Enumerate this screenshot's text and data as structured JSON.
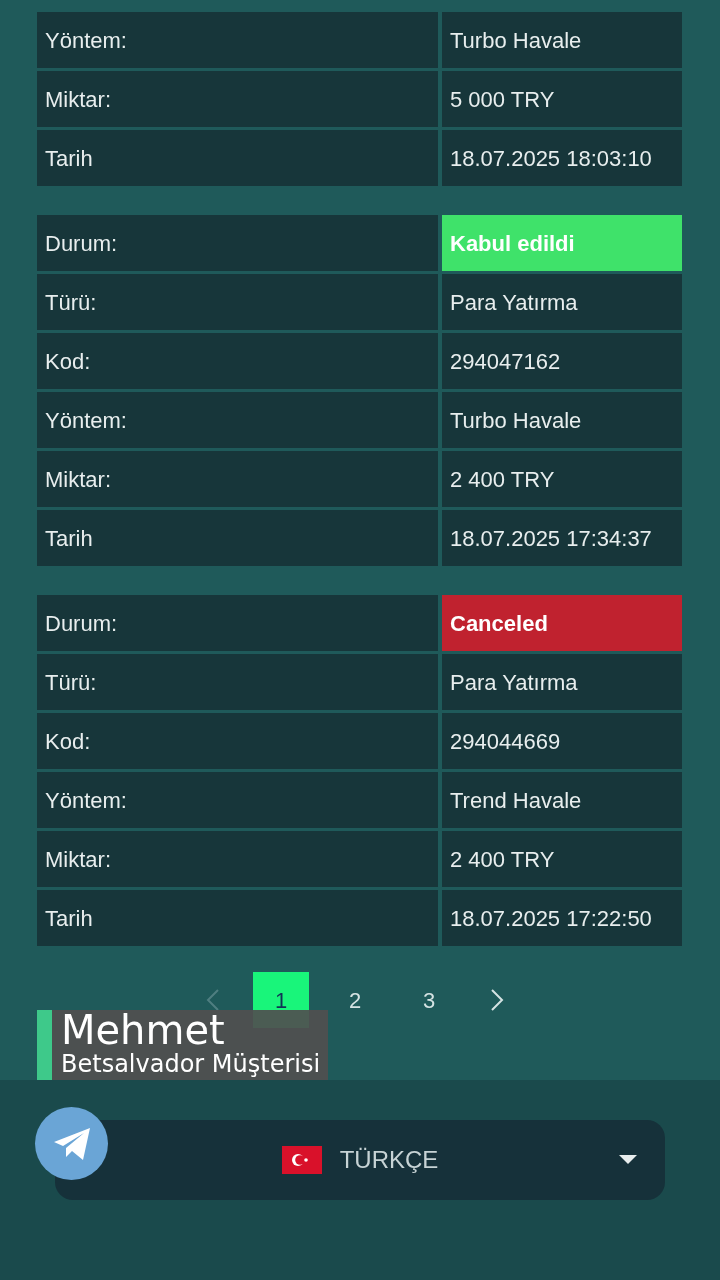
{
  "transactions": [
    {
      "rows": [
        {
          "label": "Yöntem:",
          "value": "Turbo Havale"
        },
        {
          "label": "Miktar:",
          "value": "5 000 TRY"
        },
        {
          "label": "Tarih",
          "value": "18.07.2025 18:03:10"
        }
      ]
    },
    {
      "status": {
        "label": "Durum:",
        "value": "Kabul edildi",
        "kind": "accepted"
      },
      "rows": [
        {
          "label": "Türü:",
          "value": "Para Yatırma"
        },
        {
          "label": "Kod:",
          "value": "294047162"
        },
        {
          "label": "Yöntem:",
          "value": "Turbo Havale"
        },
        {
          "label": "Miktar:",
          "value": "2 400 TRY"
        },
        {
          "label": "Tarih",
          "value": "18.07.2025 17:34:37"
        }
      ]
    },
    {
      "status": {
        "label": "Durum:",
        "value": "Canceled",
        "kind": "canceled"
      },
      "rows": [
        {
          "label": "Türü:",
          "value": "Para Yatırma"
        },
        {
          "label": "Kod:",
          "value": "294044669"
        },
        {
          "label": "Yöntem:",
          "value": "Trend Havale"
        },
        {
          "label": "Miktar:",
          "value": "2 400 TRY"
        },
        {
          "label": "Tarih",
          "value": "18.07.2025 17:22:50"
        }
      ]
    }
  ],
  "pagination": {
    "prev_disabled": true,
    "pages": [
      {
        "label": "1",
        "selected": true
      },
      {
        "label": "2",
        "selected": false
      },
      {
        "label": "3",
        "selected": false
      }
    ]
  },
  "caption": {
    "name": "Mehmet",
    "subtitle": "Betsalvador Müşterisi"
  },
  "language": {
    "label": "TÜRKÇE"
  }
}
